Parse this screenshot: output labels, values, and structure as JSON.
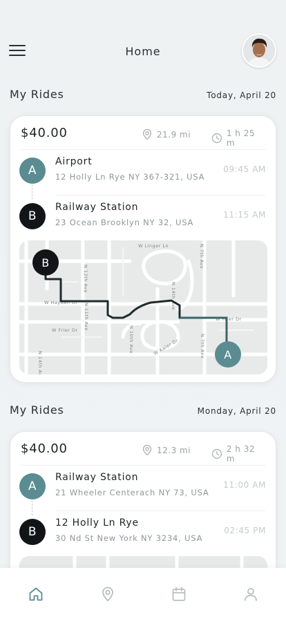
{
  "header": {
    "title": "Home"
  },
  "rides": [
    {
      "section_title": "My Rides",
      "date": "Today, April 20",
      "price": "$40.00",
      "distance": "21.9 mi",
      "duration": "1 h 25 m",
      "stops": [
        {
          "badge": "A",
          "name": "Airport",
          "address": "12 Holly Ln Rye NY 367-321, USA",
          "time": "09:45 AM"
        },
        {
          "badge": "B",
          "name": "Railway Station",
          "address": "23 Ocean Brooklyn NY 32, USA",
          "time": "11:15 AM"
        }
      ],
      "map": {
        "marker_start": "B",
        "marker_end": "A",
        "street_labels": [
          "W Linger Ln",
          "N 12th Ave",
          "N 11th Ave",
          "N 7th Ave",
          "W Hayden Dr",
          "W Frier Dr",
          "N 10th Ave",
          "N 14th Ave",
          "W Kaler Dr",
          "N 7th Ave",
          "W Frier Dr",
          "N 14th Ave"
        ]
      }
    },
    {
      "section_title": "My Rides",
      "date": "Monday, April 20",
      "price": "$40.00",
      "distance": "12.3 mi",
      "duration": "2 h 32 m",
      "stops": [
        {
          "badge": "A",
          "name": "Railway Station",
          "address": "21 Wheeler Centerach NY 73, USA",
          "time": "11:00 AM"
        },
        {
          "badge": "B",
          "name": "12 Holly Ln Rye",
          "address": "30 Nd St New York NY 3234, USA",
          "time": "02:45 PM"
        }
      ]
    }
  ],
  "colors": {
    "accent": "#5a8c91",
    "route": "#1f2a2c",
    "route_end": "#3d6467",
    "nav_active": "#5a8c91",
    "nav_inactive": "#b8bfc2"
  },
  "nav": [
    {
      "name": "home",
      "icon": "home-icon",
      "active": true
    },
    {
      "name": "location",
      "icon": "location-pin-icon",
      "active": false
    },
    {
      "name": "calendar",
      "icon": "calendar-icon",
      "active": false
    },
    {
      "name": "profile",
      "icon": "user-icon",
      "active": false
    }
  ]
}
